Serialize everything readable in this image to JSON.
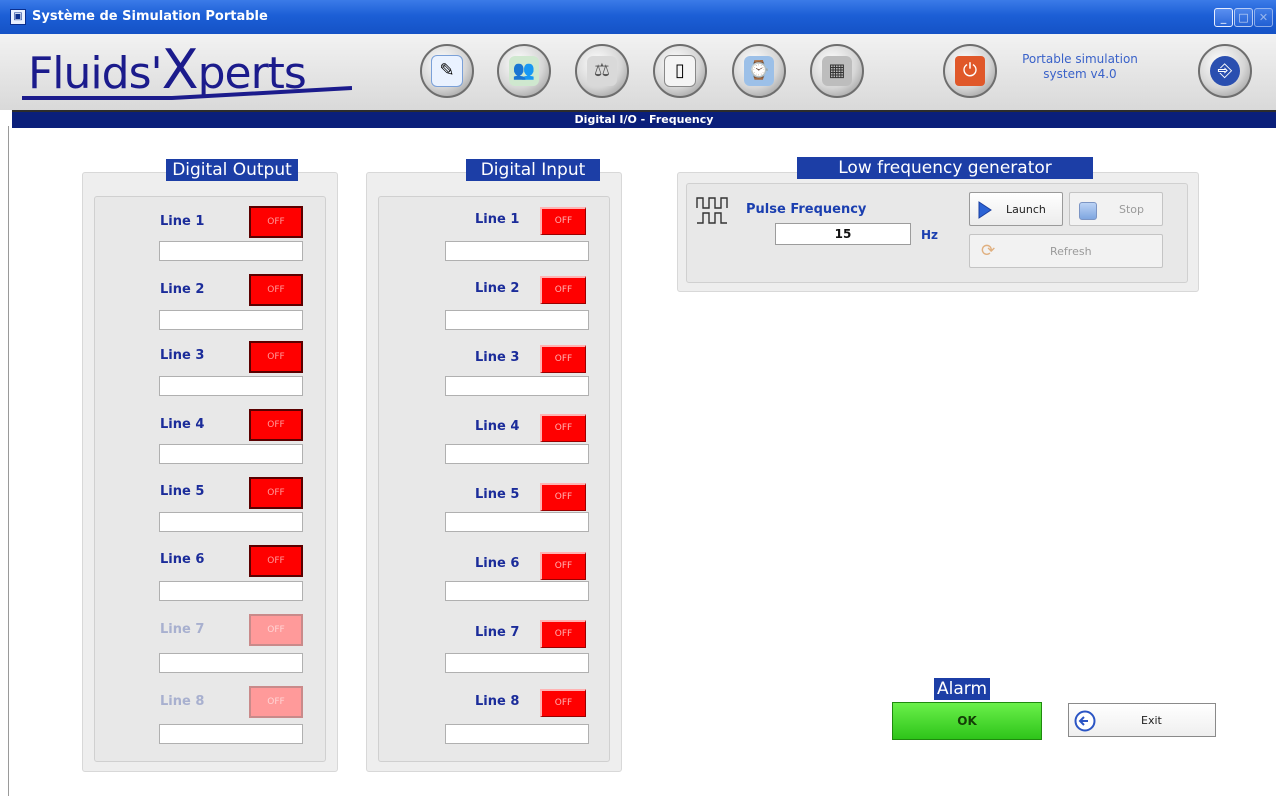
{
  "window": {
    "title": "Système de Simulation Portable"
  },
  "header": {
    "logo_main": "Fluids'",
    "logo_x": "X",
    "logo_rest": "perts",
    "version_line1": "Portable simulation",
    "version_line2": "system v4.0",
    "toolbar_icons": [
      "edit-icon",
      "users-icon",
      "scale-icon",
      "switch-icon",
      "gauge-panel-icon",
      "calculator-icon",
      "power-icon",
      "help-device-icon"
    ]
  },
  "nav": {
    "section": "Digital I/O - Frequency"
  },
  "digital_output": {
    "title": "Digital Output",
    "lines": [
      {
        "label": "Line 1",
        "state": "OFF",
        "enabled": true
      },
      {
        "label": "Line 2",
        "state": "OFF",
        "enabled": true
      },
      {
        "label": "Line 3",
        "state": "OFF",
        "enabled": true
      },
      {
        "label": "Line 4",
        "state": "OFF",
        "enabled": true
      },
      {
        "label": "Line 5",
        "state": "OFF",
        "enabled": true
      },
      {
        "label": "Line 6",
        "state": "OFF",
        "enabled": true
      },
      {
        "label": "Line 7",
        "state": "OFF",
        "enabled": false
      },
      {
        "label": "Line 8",
        "state": "OFF",
        "enabled": false
      }
    ]
  },
  "digital_input": {
    "title": "Digital Input",
    "lines": [
      {
        "label": "Line 1",
        "state": "OFF"
      },
      {
        "label": "Line 2",
        "state": "OFF"
      },
      {
        "label": "Line 3",
        "state": "OFF"
      },
      {
        "label": "Line 4",
        "state": "OFF"
      },
      {
        "label": "Line 5",
        "state": "OFF"
      },
      {
        "label": "Line 6",
        "state": "OFF"
      },
      {
        "label": "Line 7",
        "state": "OFF"
      },
      {
        "label": "Line 8",
        "state": "OFF"
      }
    ]
  },
  "generator": {
    "title": "Low frequency generator",
    "pulse_label": "Pulse Frequency",
    "frequency_value": "15",
    "unit": "Hz",
    "launch_label": "Launch",
    "stop_label": "Stop",
    "refresh_label": "Refresh"
  },
  "alarm": {
    "title": "Alarm",
    "status": "OK"
  },
  "exit": {
    "label": "Exit"
  },
  "colors": {
    "nav_bar": "#0a1f7a",
    "title_blue": "#1c3ea6",
    "off_red": "#ff0000",
    "alarm_green": "#3fd628"
  }
}
